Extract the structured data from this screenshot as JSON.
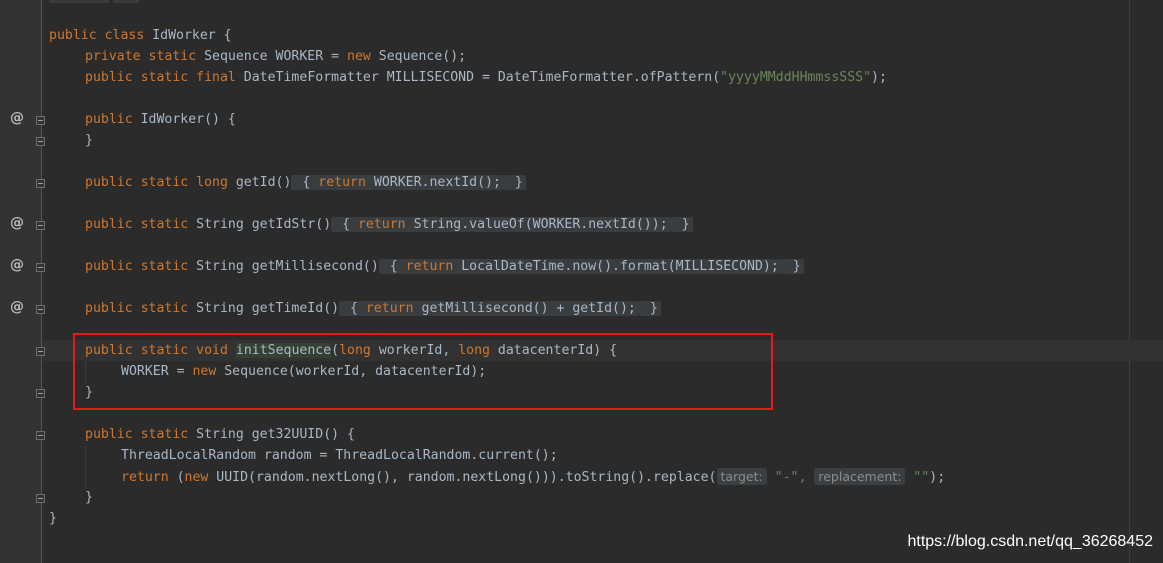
{
  "code": {
    "class_decl": {
      "kw": "public class",
      "name": " IdWorker {"
    },
    "l_worker": {
      "kw": "private static",
      "type": " Sequence WORKER = ",
      "new_kw": "new",
      "rest": " Sequence();"
    },
    "l_milli": {
      "kw": "public static final",
      "mid": " DateTimeFormatter MILLISECOND = DateTimeFormatter.ofPattern(",
      "str": "\"yyyyMMddHHmmssSSS\"",
      "rest": ");"
    },
    "l_ctor": {
      "kw": "public",
      "rest": " IdWorker() {"
    },
    "l_ctor_close": "}",
    "l_getid": {
      "kw": "public static long",
      "name": " getId()",
      "open": " {",
      "ret": "return",
      "body": " WORKER.nextId();",
      "close": " }"
    },
    "l_getidstr": {
      "kw": "public static",
      "name": " String getIdStr()",
      "open": " {",
      "ret": "return",
      "body": " String.valueOf(WORKER.nextId());",
      "close": " }"
    },
    "l_getmilli": {
      "kw": "public static",
      "name": " String getMillisecond()",
      "open": " {",
      "ret": "return",
      "body": " LocalDateTime.now().format(MILLISECOND);",
      "close": " }"
    },
    "l_gettime": {
      "kw": "public static",
      "name": " String getTimeId()",
      "open": " {",
      "ret": "return",
      "body": " getMillisecond() + getId();",
      "close": " }"
    },
    "l_init": {
      "kw": "public static void",
      "sp": " ",
      "name": "initSequence",
      "p1": "(",
      "long1": "long",
      "a1": " workerId, ",
      "long2": "long",
      "a2": " datacenterId) {"
    },
    "l_init_body": {
      "a": "WORKER = ",
      "new_kw": "new",
      "b": " Sequence(workerId, datacenterId);"
    },
    "l_init_close": "}",
    "l_uuid": {
      "kw": "public static",
      "rest": " String get32UUID() {"
    },
    "l_random": {
      "a": "ThreadLocalRandom random = ThreadLocalRandom.current();"
    },
    "l_return": {
      "ret": "return",
      "p1": " (",
      "new_kw": "new",
      "p2": " UUID(random.nextLong(), random.nextLong())).toString().replace(",
      "hint1": "target:",
      "s1": " \"-\",",
      "hint2": "replacement:",
      "s2": " \"\"",
      "end": ");"
    },
    "l_uuid_close": "}",
    "l_class_close": "}"
  },
  "gutter": {
    "at_symbol": "@"
  },
  "watermark": "https://blog.csdn.net/qq_36268452"
}
